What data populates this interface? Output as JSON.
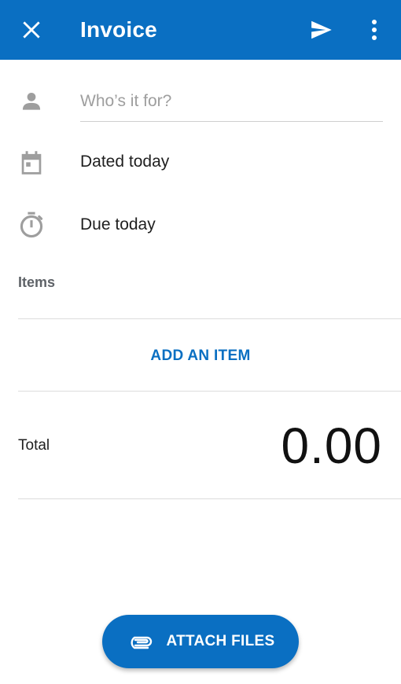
{
  "toolbar": {
    "title": "Invoice",
    "background_color": "#0a6fc2",
    "close_icon": "close-icon",
    "send_icon": "send-icon",
    "more_icon": "more-vertical-icon"
  },
  "form": {
    "recipient": {
      "icon": "person-icon",
      "placeholder": "Who’s it for?",
      "value": ""
    },
    "date": {
      "icon": "calendar-icon",
      "label": "Dated today"
    },
    "due": {
      "icon": "timer-icon",
      "label": "Due today"
    }
  },
  "items": {
    "section_label": "Items",
    "add_label": "ADD AN ITEM"
  },
  "total": {
    "label": "Total",
    "value": "0.00"
  },
  "attach": {
    "label": "ATTACH FILES",
    "icon": "paperclip-icon"
  },
  "colors": {
    "accent": "#0a6fc2",
    "icon_gray": "#9e9e9e",
    "text": "#1f1f1f"
  }
}
